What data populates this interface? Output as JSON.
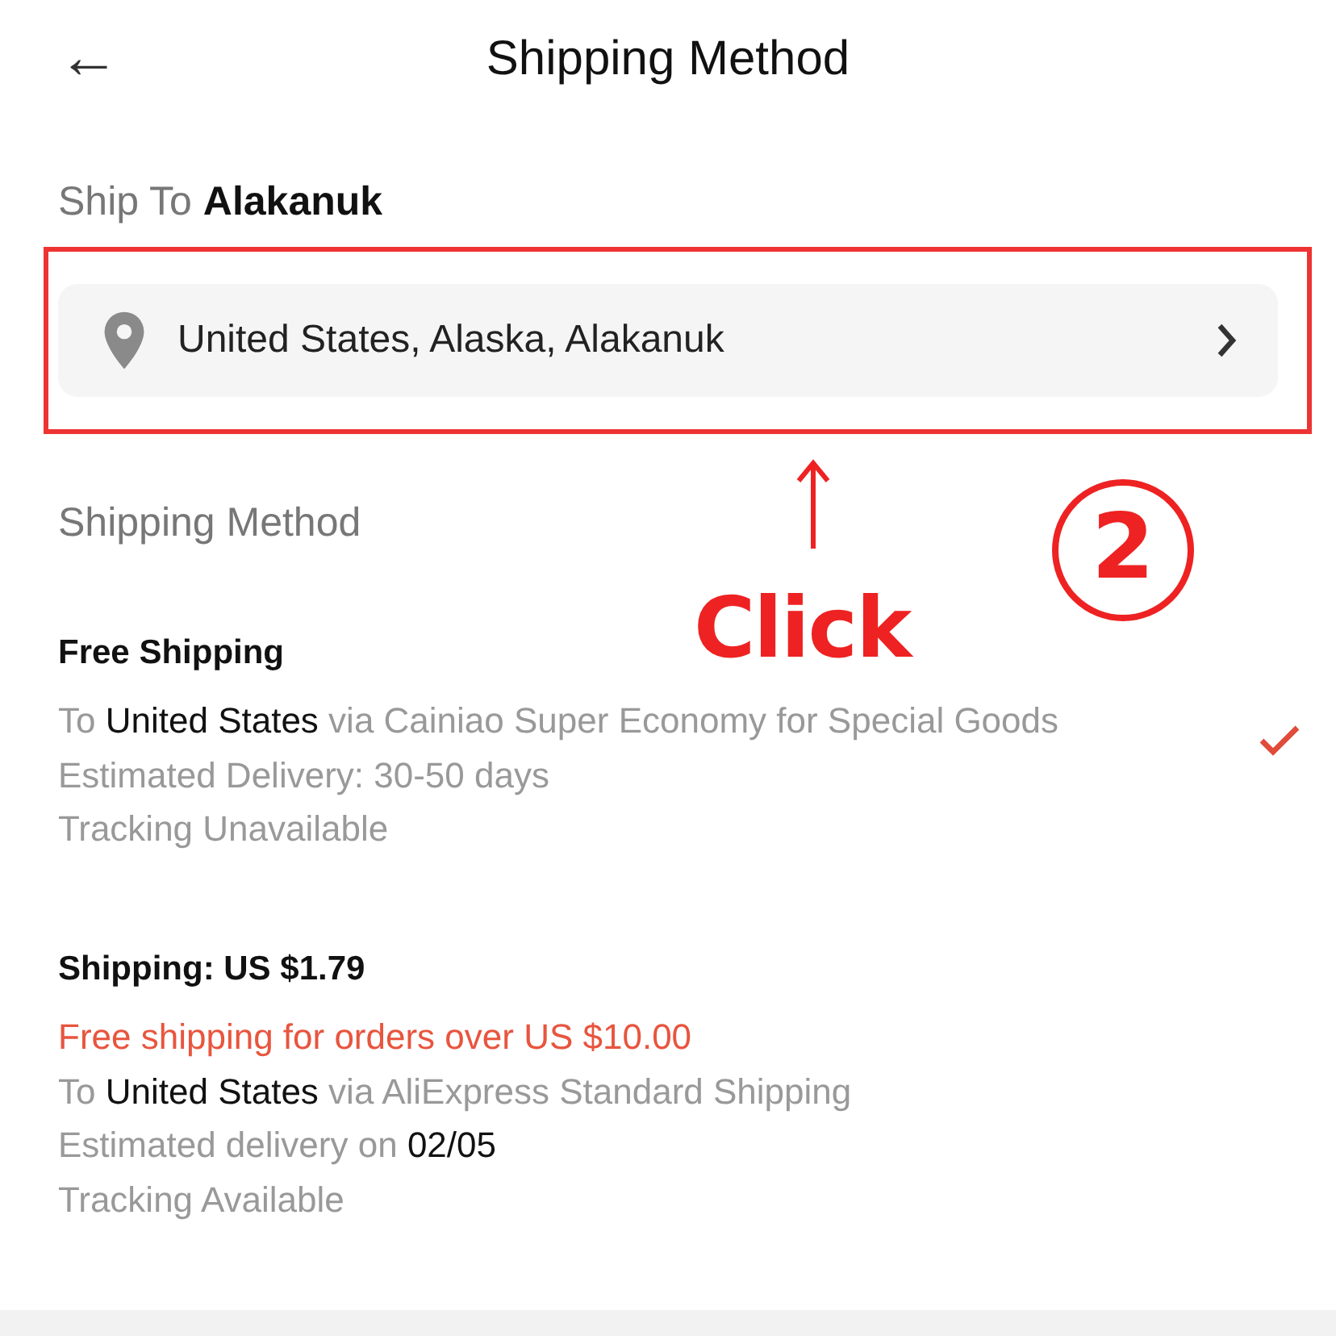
{
  "header": {
    "back": "←",
    "title": "Shipping Method"
  },
  "ship_to": {
    "label": "Ship To",
    "city": "Alakanuk"
  },
  "address": {
    "text": "United States, Alaska, Alakanuk"
  },
  "section_title": "Shipping Method",
  "options": [
    {
      "title": "Free Shipping",
      "selected": true,
      "lines": [
        {
          "kind": "info",
          "parts": [
            {
              "text": "To ",
              "dark": false
            },
            {
              "text": "United States",
              "dark": true
            },
            {
              "text": " via Cainiao Super Economy for Special Goods",
              "dark": false
            }
          ]
        },
        {
          "kind": "info",
          "parts": [
            {
              "text": "Estimated Delivery: 30-50 days",
              "dark": false
            }
          ]
        },
        {
          "kind": "info",
          "parts": [
            {
              "text": "Tracking Unavailable",
              "dark": false
            }
          ]
        }
      ]
    },
    {
      "title": "Shipping: US $1.79",
      "selected": false,
      "lines": [
        {
          "kind": "promo",
          "parts": [
            {
              "text": "Free shipping for orders over US $10.00",
              "dark": false
            }
          ]
        },
        {
          "kind": "info",
          "parts": [
            {
              "text": "To ",
              "dark": false
            },
            {
              "text": "United States",
              "dark": true
            },
            {
              "text": " via AliExpress Standard Shipping",
              "dark": false
            }
          ]
        },
        {
          "kind": "info",
          "parts": [
            {
              "text": "Estimated delivery on ",
              "dark": false
            },
            {
              "text": "02/05",
              "dark": true
            }
          ]
        },
        {
          "kind": "info",
          "parts": [
            {
              "text": "Tracking Available",
              "dark": false
            }
          ]
        }
      ]
    }
  ],
  "annotation": {
    "label": "Click",
    "step": "2"
  }
}
